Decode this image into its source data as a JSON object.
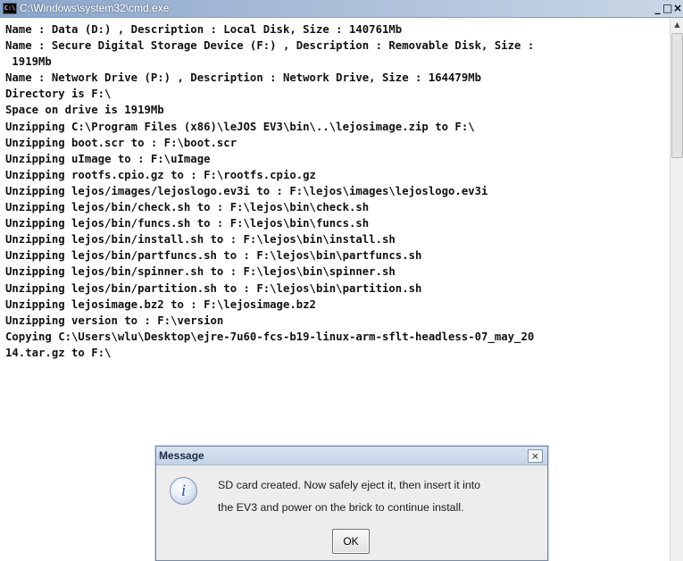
{
  "window": {
    "title": "C:\\Windows\\system32\\cmd.exe",
    "icon_label": "C:\\",
    "minimize_glyph": "_",
    "maximize_glyph": "□",
    "close_glyph": "×"
  },
  "console": {
    "lines": [
      "Name : Data (D:) , Description : Local Disk, Size : 140761Mb",
      "Name : Secure Digital Storage Device (F:) , Description : Removable Disk, Size :",
      " 1919Mb",
      "Name : Network Drive (P:) , Description : Network Drive, Size : 164479Mb",
      "Directory is F:\\",
      "Space on drive is 1919Mb",
      "Unzipping C:\\Program Files (x86)\\leJOS EV3\\bin\\..\\lejosimage.zip to F:\\",
      "Unzipping boot.scr to : F:\\boot.scr",
      "Unzipping uImage to : F:\\uImage",
      "Unzipping rootfs.cpio.gz to : F:\\rootfs.cpio.gz",
      "Unzipping lejos/images/lejoslogo.ev3i to : F:\\lejos\\images\\lejoslogo.ev3i",
      "Unzipping lejos/bin/check.sh to : F:\\lejos\\bin\\check.sh",
      "Unzipping lejos/bin/funcs.sh to : F:\\lejos\\bin\\funcs.sh",
      "Unzipping lejos/bin/install.sh to : F:\\lejos\\bin\\install.sh",
      "Unzipping lejos/bin/partfuncs.sh to : F:\\lejos\\bin\\partfuncs.sh",
      "Unzipping lejos/bin/spinner.sh to : F:\\lejos\\bin\\spinner.sh",
      "Unzipping lejos/bin/partition.sh to : F:\\lejos\\bin\\partition.sh",
      "Unzipping lejosimage.bz2 to : F:\\lejosimage.bz2",
      "Unzipping version to : F:\\version",
      "Copying C:\\Users\\wlu\\Desktop\\ejre-7u60-fcs-b19-linux-arm-sflt-headless-07_may_20",
      "14.tar.gz to F:\\"
    ]
  },
  "dialog": {
    "title": "Message",
    "close_glyph": "×",
    "icon_glyph": "i",
    "message_line1": "SD card created. Now safely eject it, then insert it into",
    "message_line2": "the EV3 and power on the brick to continue install.",
    "ok_label": "OK"
  },
  "colors": {
    "console_background": "#ffffff",
    "console_text": "#111111",
    "titlebar": "#8aa4c8",
    "dialog_background": "#ededed"
  }
}
